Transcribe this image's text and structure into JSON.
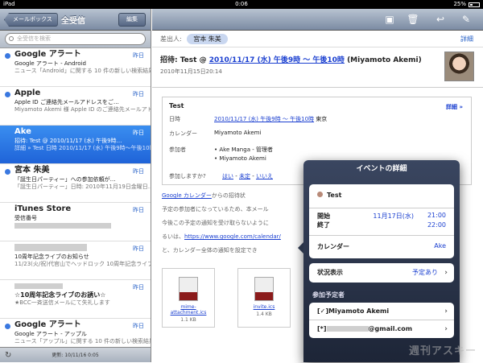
{
  "status": {
    "device": "iPad",
    "time": "0:06",
    "battery": "25%"
  },
  "sidebar": {
    "back_label": "メールボックス",
    "title": "全受信",
    "edit_label": "編集",
    "search_placeholder": "全受信を検索",
    "messages": [
      {
        "from": "Google アラート",
        "date": "昨日",
        "subject": "Google アラート - Android",
        "preview": "ニュース「Android」に関する 10 件の新しい検索結果 エレコム、Android向けシステム…",
        "unread": true
      },
      {
        "from": "Apple",
        "date": "昨日",
        "subject": "Apple ID ご連絡先メールアドレスをご…",
        "preview": "Miyamoto Akemi 様 Apple ID のご連絡先メールアドレスを確認…",
        "unread": true
      },
      {
        "from": "Ake",
        "date": "昨日",
        "subject": "招待: Test @ 2010/11/17 (水) 午後9時…",
        "preview": "詳細 » Test 日時 2010/11/17 (水) 午後9時～午後10時 東京 カレン…",
        "unread": false,
        "selected": true
      },
      {
        "from": "宮本 朱美",
        "date": "昨日",
        "subject": "「誕生日パーティー」への参加依頼が…",
        "preview": "「誕生日パーティー」日時: 2010年11月19日金曜日…",
        "unread": true
      },
      {
        "from": "iTunes Store",
        "date": "昨日",
        "subject": "受信番号",
        "preview": "",
        "unread": false
      },
      {
        "from": "",
        "date": "昨日",
        "subject": "10周年記念ライブのお知らせ",
        "preview": "11/23(火/祝)代官山でヘッドロック 10周年記念ライブをやります。NUM42とスペシャ…",
        "unread": false
      },
      {
        "from": "☆10周年記念ライブのお誘い☆",
        "date": "昨日",
        "subject": "★BCC一斉送信メールにて失礼します",
        "preview": "",
        "unread": false
      },
      {
        "from": "Google アラート",
        "date": "昨日",
        "subject": "Google アラート - アップル",
        "preview": "ニュース「アップル」に関する 10 件の新しい検索結果 アップル、iPhone…",
        "unread": true
      }
    ],
    "updated_label": "更新:",
    "updated_value": "10/11/16 0:05"
  },
  "message": {
    "from_label": "差出人:",
    "from_name": "宮本 朱美",
    "detail_link": "詳細",
    "title_prefix": "招待: Test @ ",
    "title_link": "2010/11/17 (水) 午後9時 ～ 午後10時",
    "title_suffix": " (Miyamoto Akemi)",
    "received": "2010年11月15日20:14",
    "card": {
      "title": "Test",
      "detail": "詳細 »",
      "date_label": "日時",
      "date_link": "2010/11/17 (水) 午後9時 ～ 午後10時",
      "date_place": " 東京",
      "cal_label": "カレンダー",
      "cal_value": "Miyamoto Akemi",
      "att_label": "参加者",
      "att_1": "• Ake Manga - 管理者",
      "att_2": "• Miyamoto Akemi",
      "rsvp_label": "参加しますか?",
      "rsvp_yes": "はい",
      "rsvp_maybe": "未定",
      "rsvp_no": "いいえ"
    },
    "body": {
      "cal_link": "Google カレンダー",
      "from_text": "からの招待状",
      "line2": "予定の参加者になっているため、本メール",
      "line3": "今後この予定の通知を受け取らないように",
      "line4": "るいは、",
      "url": "https://www.google.com/calendar/",
      "line5": "と、カレンダー全体の通知を設定でき"
    },
    "attachments": [
      {
        "name": "mime-attachment.ics",
        "size": "1.1 KB"
      },
      {
        "name": "invite.ics",
        "size": "1.4 KB"
      }
    ]
  },
  "popover": {
    "title": "イベントの詳細",
    "event_name": "Test",
    "start_label": "開始",
    "end_label": "終了",
    "start_date": "11月17日(水)",
    "start_time": "21:00",
    "end_time": "22:00",
    "cal_label": "カレンダー",
    "cal_value": "Ake",
    "status_label": "状況表示",
    "status_value": "予定あり",
    "attendees_header": "参加予定者",
    "attendee_1": "[✓]Miyamoto Akemi",
    "attendee_2_prefix": "[*]",
    "attendee_2_suffix": "@gmail.com"
  },
  "colors": {
    "accent": "#1f63d8",
    "link": "#1a3fd0"
  }
}
